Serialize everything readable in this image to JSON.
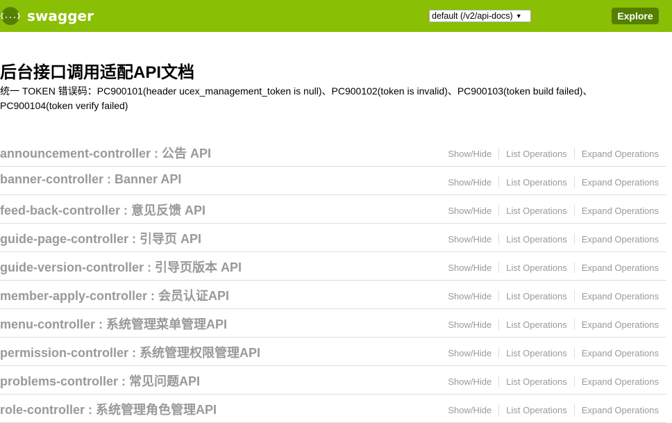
{
  "header": {
    "logo_icon": "{...}",
    "logo_text": "swagger",
    "api_select_value": "default (/v2/api-docs)",
    "explore_label": "Explore",
    "colors": {
      "bar": "#89bf04",
      "button": "#547f00"
    }
  },
  "info": {
    "title": "后台接口调用适配API文档",
    "description": "统一 TOKEN 错误码：PC900101(header ucex_management_token is null)、PC900102(token is invalid)、PC900103(token build failed)、PC900104(token verify failed)"
  },
  "resources": [
    {
      "title": "announcement-controller : 公告 API",
      "show_hide": "Show/Hide",
      "list_ops": "List Operations",
      "expand_ops": "Expand Operations"
    },
    {
      "title": "banner-controller : Banner API",
      "show_hide": "Show/Hide",
      "list_ops": "List Operations",
      "expand_ops": "Expand Operations"
    },
    {
      "title": "feed-back-controller : 意见反馈 API",
      "show_hide": "Show/Hide",
      "list_ops": "List Operations",
      "expand_ops": "Expand Operations"
    },
    {
      "title": "guide-page-controller : 引导页 API",
      "show_hide": "Show/Hide",
      "list_ops": "List Operations",
      "expand_ops": "Expand Operations"
    },
    {
      "title": "guide-version-controller : 引导页版本 API",
      "show_hide": "Show/Hide",
      "list_ops": "List Operations",
      "expand_ops": "Expand Operations"
    },
    {
      "title": "member-apply-controller : 会员认证API",
      "show_hide": "Show/Hide",
      "list_ops": "List Operations",
      "expand_ops": "Expand Operations"
    },
    {
      "title": "menu-controller : 系统管理菜单管理API",
      "show_hide": "Show/Hide",
      "list_ops": "List Operations",
      "expand_ops": "Expand Operations"
    },
    {
      "title": "permission-controller : 系统管理权限管理API",
      "show_hide": "Show/Hide",
      "list_ops": "List Operations",
      "expand_ops": "Expand Operations"
    },
    {
      "title": "problems-controller : 常见问题API",
      "show_hide": "Show/Hide",
      "list_ops": "List Operations",
      "expand_ops": "Expand Operations"
    },
    {
      "title": "role-controller : 系统管理角色管理API",
      "show_hide": "Show/Hide",
      "list_ops": "List Operations",
      "expand_ops": "Expand Operations"
    }
  ]
}
